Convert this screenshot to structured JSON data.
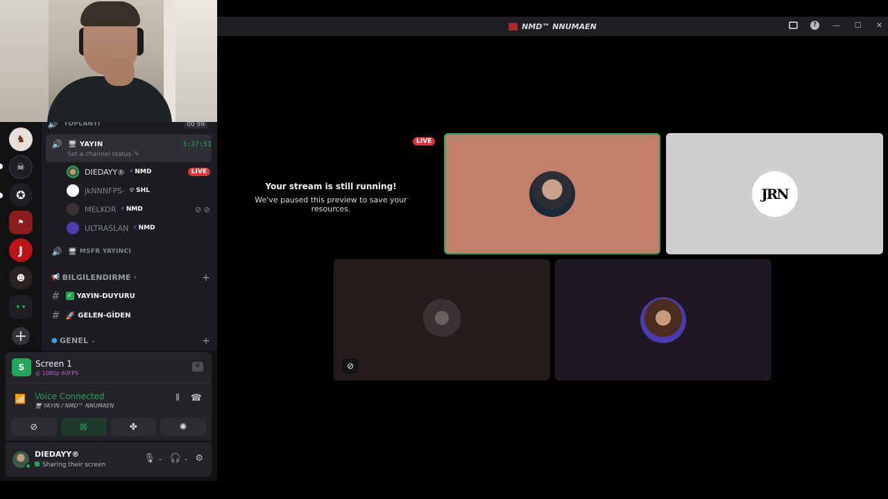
{
  "window": {
    "title": "NMD™ NNUMAEN"
  },
  "channels": {
    "voice_top": {
      "name": "TOPLANTI",
      "count_a": "00",
      "count_b": "99"
    },
    "voice_active": {
      "name": "YAYIN",
      "timer": "3:37:51",
      "status_placeholder": "Set a channel status",
      "users": [
        {
          "name": "DIEDAYY®",
          "tag": "NMD",
          "live": "LIVE"
        },
        {
          "name": "jkNNNFPS-",
          "tag": "SHL"
        },
        {
          "name": "MELKOR",
          "tag": "NMD"
        },
        {
          "name": "ULTRASLAN",
          "tag": "NMD"
        }
      ]
    },
    "voice_other": {
      "name": "MSFR YAYINCI"
    },
    "category_info": {
      "name": "BILGILENDIRME"
    },
    "text_channels": [
      {
        "name": "YAYIN-DUYURU"
      },
      {
        "name": "GELEN-GİDEN"
      }
    ],
    "category_general": {
      "name": "GENEL"
    }
  },
  "screen_share": {
    "title": "Screen 1",
    "quality": "1080p 60FPS"
  },
  "voice": {
    "title": "Voice Connected",
    "location": "YAYIN / NMD™ NNUMAEN"
  },
  "user": {
    "name": "DIEDAYY®",
    "status": "Sharing their screen"
  },
  "stage": {
    "paused_title": "Your stream is still running!",
    "paused_sub": "We've paused this preview to save your resources.",
    "live_label": "LIVE",
    "tile_b_logo": "JRN"
  },
  "colors": {
    "accent_green": "#23a55a",
    "live_red": "#da373c",
    "nitro_purple": "#8c7bff"
  }
}
